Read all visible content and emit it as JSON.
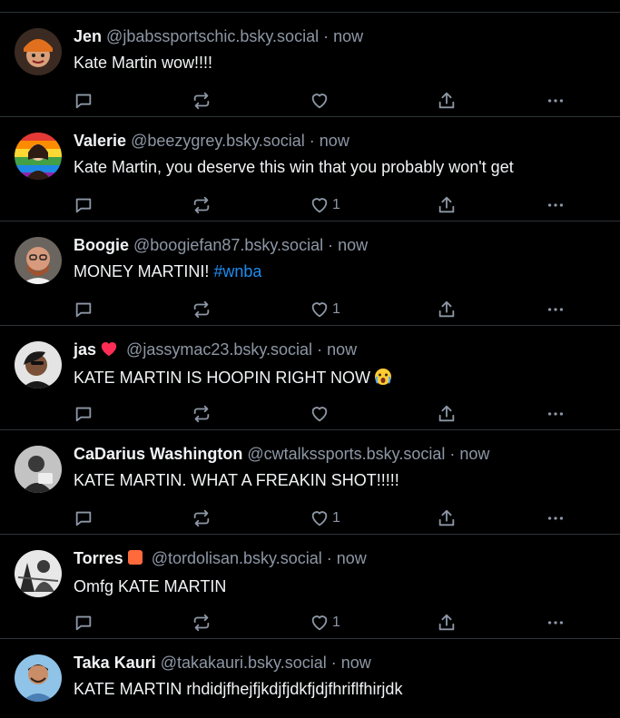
{
  "posts": [
    {
      "name": "Jen",
      "handle": "@jbabssportschic.bsky.social",
      "sep": "·",
      "time": "now",
      "text": "Kate Martin wow!!!!",
      "like_count": "",
      "avatar": "avatar-jen"
    },
    {
      "name": "Valerie",
      "handle": "@beezygrey.bsky.social",
      "sep": "·",
      "time": "now",
      "text": "Kate Martin, you deserve this win that you probably won't get",
      "like_count": "1",
      "avatar": "avatar-valerie"
    },
    {
      "name": "Boogie",
      "handle": "@boogiefan87.bsky.social",
      "sep": "·",
      "time": "now",
      "text": "MONEY MARTINI!",
      "hashtag": "#wnba",
      "like_count": "1",
      "avatar": "avatar-boogie"
    },
    {
      "name": "jas",
      "badge": "heart-emoji",
      "handle": "@jassymac23.bsky.social",
      "sep": "·",
      "time": "now",
      "text": "KATE MARTIN IS HOOPIN RIGHT NOW",
      "emoji": "crying-face-emoji",
      "like_count": "",
      "avatar": "avatar-jas"
    },
    {
      "name": "CaDarius Washington",
      "handle": "@cwtalkssports.bsky.social",
      "sep": "·",
      "time": "now",
      "text": "KATE MARTIN. WHAT A FREAKIN SHOT!!!!!",
      "like_count": "1",
      "avatar": "avatar-cadarius"
    },
    {
      "name": "Torres",
      "badge": "orange-square-emoji",
      "handle": "@tordolisan.bsky.social",
      "sep": "·",
      "time": "now",
      "text": "Omfg KATE MARTIN",
      "like_count": "1",
      "avatar": "avatar-torres"
    },
    {
      "name": "Taka Kauri",
      "handle": "@takakauri.bsky.social",
      "sep": "·",
      "time": "now",
      "text": "KATE MARTIN rhdidjfhejfjkdjfjdkfjdjfhriflfhirjdk",
      "like_count": "",
      "avatar": "avatar-taka"
    }
  ],
  "colors": {
    "background": "#000000",
    "text": "#f1f3f5",
    "muted": "#8d97a5",
    "divider": "#2e3438",
    "link": "#1d8cf0",
    "heart": "#ff2d55"
  }
}
